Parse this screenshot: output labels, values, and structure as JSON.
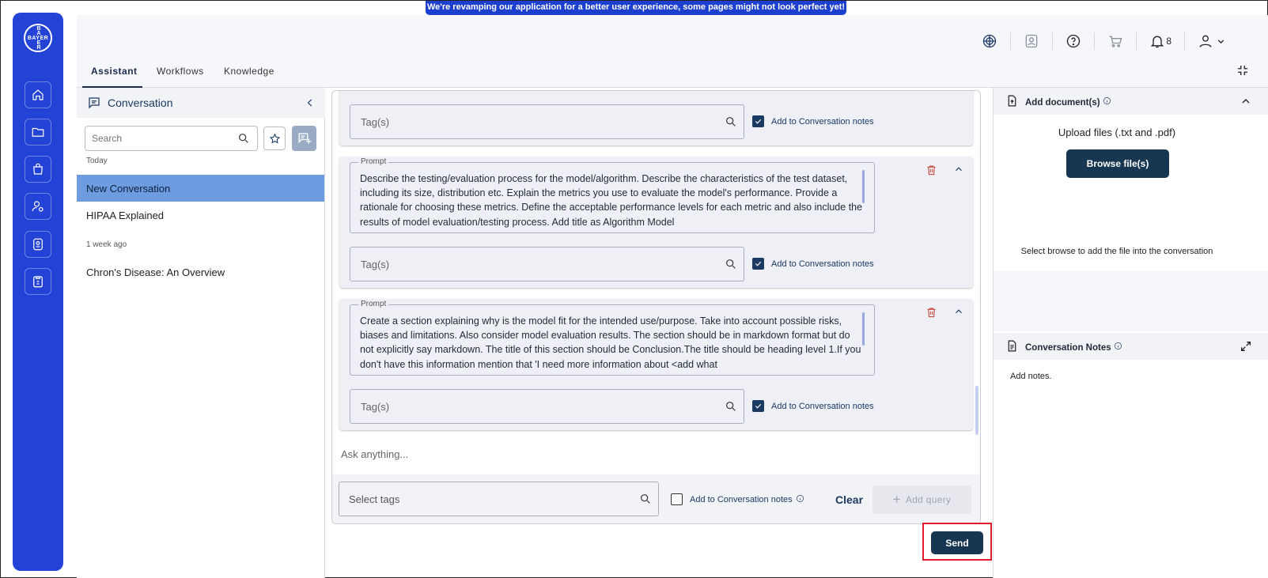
{
  "banner": "We're revamping our application for a better user experience, some pages might not look perfect yet!",
  "rail": {
    "logo_h": "BAYER",
    "logo_v": [
      "B",
      "A",
      "Y",
      "E",
      "R"
    ],
    "items": [
      "home-icon",
      "folder-icon",
      "bag-icon",
      "user-settings-icon",
      "id-badge-icon",
      "clipboard-icon"
    ]
  },
  "topbar": {
    "notification_count": "8"
  },
  "tabs": [
    "Assistant",
    "Workflows",
    "Knowledge"
  ],
  "sidebar": {
    "title": "Conversation",
    "search_placeholder": "Search",
    "groups": [
      {
        "label": "Today",
        "items": [
          "New Conversation",
          "HIPAA Explained"
        ]
      },
      {
        "label": "1 week ago",
        "items": [
          "Chron's Disease: An Overview"
        ]
      }
    ]
  },
  "prompts": [
    {
      "label": "Prompt",
      "text": "Describe the testing/evaluation process for the model/algorithm. Describe the characteristics of the test dataset, including its size, distribution etc. Explain the metrics you use to evaluate the model's performance. Provide a rationale for choosing these metrics. Define the acceptable performance levels for each metric and also include the results of model evaluation/testing process. Add title as Algorithm Model"
    },
    {
      "label": "Prompt",
      "text": "Create a section explaining why is the model fit for the intended use/purpose. Take into account possible risks, biases and limitations. Also consider model evaluation results. The section should be in markdown format but do not explicitly say markdown. The title of this section should be Conclusion.The title should be heading level 1.If you don't have this information mention that 'I need more information about <add what"
    }
  ],
  "tag_placeholder": "Tag(s)",
  "add_to_notes": "Add to Conversation notes",
  "composer": {
    "ask_placeholder": "Ask anything...",
    "select_tags_placeholder": "Select tags",
    "clear": "Clear",
    "add_query": "Add query",
    "send": "Send"
  },
  "right_panel": {
    "add_docs_title": "Add document(s)",
    "upload_label": "Upload files (.txt and .pdf)",
    "browse_button": "Browse file(s)",
    "browse_hint": "Select browse to add the file into the conversation",
    "notes_title": "Conversation Notes",
    "notes_placeholder": "Add notes."
  },
  "colors": {
    "rail": "#2342d6",
    "primary": "#173652",
    "active_row": "#6d9de0",
    "highlight": "#e11d2a"
  }
}
